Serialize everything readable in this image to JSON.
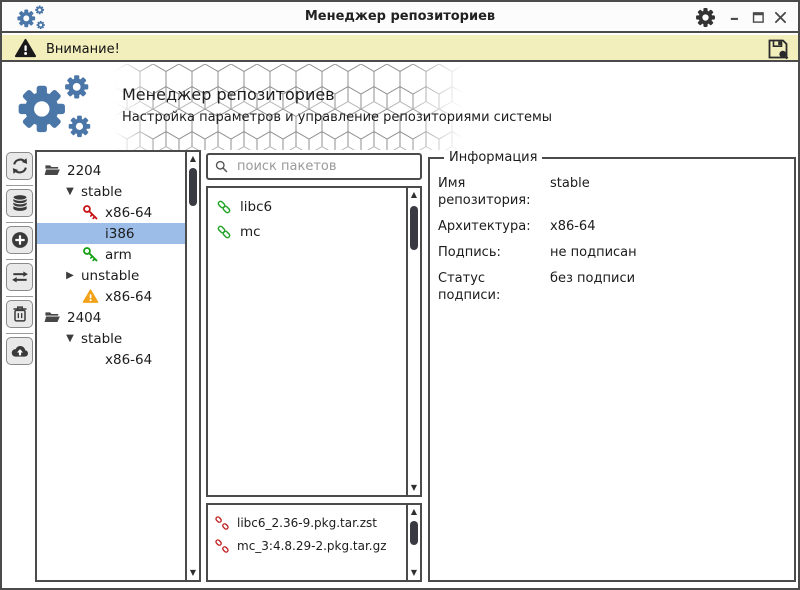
{
  "window": {
    "title": "Менеджер репозиториев",
    "controls": [
      {
        "icon": "minimize"
      },
      {
        "icon": "maximize"
      },
      {
        "icon": "close"
      }
    ],
    "settings_icon": "gear"
  },
  "banner": {
    "icon": "warning-triangle",
    "text": "Внимание!",
    "save_icon": "floppy-save",
    "bg_color": "#f2efbd"
  },
  "header": {
    "logo_icon": "gears",
    "title": "Менеджер репозиториев",
    "subtitle": "Настройка параметров и управление репозиториями системы",
    "logo_color": "#4b76a8"
  },
  "toolbar": {
    "buttons": [
      {
        "icon": "refresh"
      },
      {
        "icon": "database"
      },
      {
        "icon": "add-circle"
      },
      {
        "icon": "transfer-arrows"
      },
      {
        "icon": "trash"
      },
      {
        "icon": "cloud-upload"
      }
    ]
  },
  "tree": {
    "items": [
      {
        "label": "2204",
        "level": 0,
        "icon": "folder-open"
      },
      {
        "label": "stable",
        "level": 1,
        "expander": "expanded"
      },
      {
        "label": "x86-64",
        "level": 2,
        "icon": "key-red"
      },
      {
        "label": "i386",
        "level": 2,
        "icon": null,
        "selected": true
      },
      {
        "label": "arm",
        "level": 2,
        "icon": "key-green"
      },
      {
        "label": "unstable",
        "level": 1,
        "expander": "collapsed"
      },
      {
        "label": "x86-64",
        "level": 2,
        "icon": "warning-triangle"
      },
      {
        "label": "2404",
        "level": 0,
        "icon": "folder-open"
      },
      {
        "label": "stable",
        "level": 1,
        "expander": "expanded"
      },
      {
        "label": "x86-64",
        "level": 2,
        "icon": null
      }
    ]
  },
  "packages": {
    "search_placeholder": "поиск пакетов",
    "items": [
      {
        "name": "libc6",
        "icon": "link"
      },
      {
        "name": "mc",
        "icon": "link"
      }
    ]
  },
  "files": {
    "items": [
      {
        "name": "libc6_2.36-9.pkg.tar.zst",
        "icon": "broken-link"
      },
      {
        "name": "mc_3:4.8.29-2.pkg.tar.gz",
        "icon": "broken-link"
      }
    ]
  },
  "info": {
    "legend": "Информация",
    "rows": [
      {
        "label": "Имя репозитория:",
        "value": "stable"
      },
      {
        "label": "Архитектура:",
        "value": "x86-64"
      },
      {
        "label": "Подпись:",
        "value": "не подписан"
      },
      {
        "label": "Статус подписи:",
        "value": "без подписи"
      }
    ]
  },
  "colors": {
    "accent_blue": "#4b76a8",
    "selection": "#9cbde8",
    "banner_bg": "#f2efbd",
    "border": "#4b4b4b",
    "key_red": "#c81414",
    "key_green": "#13a013",
    "warning_orange": "#f2a218",
    "link_green": "#23a428",
    "broken_red": "#c42828"
  }
}
